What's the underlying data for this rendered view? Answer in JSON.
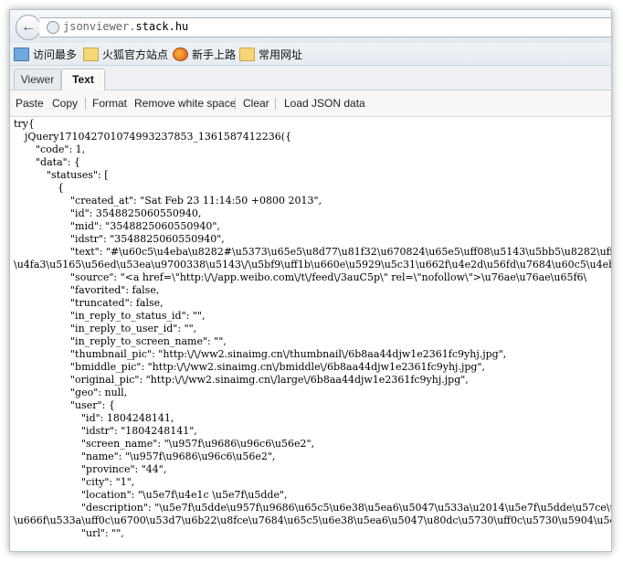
{
  "browser": {
    "url_prefix": "jsonviewer.",
    "url_domain": "stack.hu",
    "bookmarks": [
      {
        "label": "访问最多",
        "icon": "most-visited-icon"
      },
      {
        "label": "火狐官方站点",
        "icon": "folder-icon"
      },
      {
        "label": "新手上路",
        "icon": "firefox-icon"
      },
      {
        "label": "常用网址",
        "icon": "folder-icon"
      }
    ]
  },
  "tabs": [
    {
      "label": "Viewer",
      "active": false
    },
    {
      "label": "Text",
      "active": true
    }
  ],
  "toolbar": {
    "paste": "Paste",
    "copy": "Copy",
    "format": "Format",
    "remove_ws": "Remove white space",
    "clear": "Clear",
    "load_json": "Load JSON data"
  },
  "editor": {
    "lines": [
      "try{",
      "jQuery17104270107499323785З_1361587412236({",
      "\"code\": 1,",
      "\"data\": {",
      "\"statuses\": [",
      "{",
      "\"created_at\": \"Sat Feb 23 11:14:50 +0800 2013\",",
      "\"id\": 3548825060550940,",
      "\"mid\": \"3548825060550940\",",
      "\"idstr\": \"3548825060550940\",",
      "\"text\": \"#\\u60c5\\u4eba\\u8282#\\u5373\\u65e5\\u8d77\\u81f32\\u670824\\u65e5\\uff08\\u5143\\u5bb5\\u8282\\uff09\\",
      "\\u4fa3\\u5165\\u56ed\\u53ea\\u9700338\\u5143\\/\\u5bf9\\uff1b\\u660e\\u5929\\u5c31\\u662f\\u4e2d\\u56fd\\u7684\\u60c5\\u4eba\\u",
      "\"source\": \"<a href=\\\"http:\\/\\/app.weibo.com\\/t\\/feed\\/3auC5p\\\" rel=\\\"nofollow\\\">\\u76ae\\u76ae\\u65f6\\",
      "\"favorited\": false,",
      "\"truncated\": false,",
      "\"in_reply_to_status_id\": \"\",",
      "\"in_reply_to_user_id\": \"\",",
      "\"in_reply_to_screen_name\": \"\",",
      "\"thumbnail_pic\": \"http:\\/\\/ww2.sinaimg.cn\\/thumbnail\\/6b8aa44djw1e2361fc9yhj.jpg\",",
      "\"bmiddle_pic\": \"http:\\/\\/ww2.sinaimg.cn\\/bmiddle\\/6b8aa44djw1e2361fc9yhj.jpg\",",
      "\"original_pic\": \"http:\\/\\/ww2.sinaimg.cn\\/large\\/6b8aa44djw1e2361fc9yhj.jpg\",",
      "\"geo\": null,",
      "\"user\": {",
      "\"id\": 1804248141,",
      "\"idstr\": \"1804248141\",",
      "\"screen_name\": \"\\u957f\\u9686\\u96c6\\u56e2\",",
      "\"name\": \"\\u957f\\u9686\\u96c6\\u56e2\",",
      "\"province\": \"44\",",
      "\"city\": \"1\",",
      "\"location\": \"\\u5e7f\\u4e1c \\u5e7f\\u5dde\",",
      "\"description\": \"\\u5e7f\\u5dde\\u957f\\u9686\\u65c5\\u6e38\\u5ea6\\u5047\\u533a\\u2014\\u5e7f\\u5dde\\u57ce\\u5",
      "\\u666f\\u533a\\uff0c\\u6700\\u53d7\\u6b22\\u8fce\\u7684\\u65c5\\u6e38\\u5ea6\\u5047\\u80dc\\u5730\\uff0c\\u5730\\u5904\\u5e7f\\",
      "\"url\": \"\","
    ]
  }
}
